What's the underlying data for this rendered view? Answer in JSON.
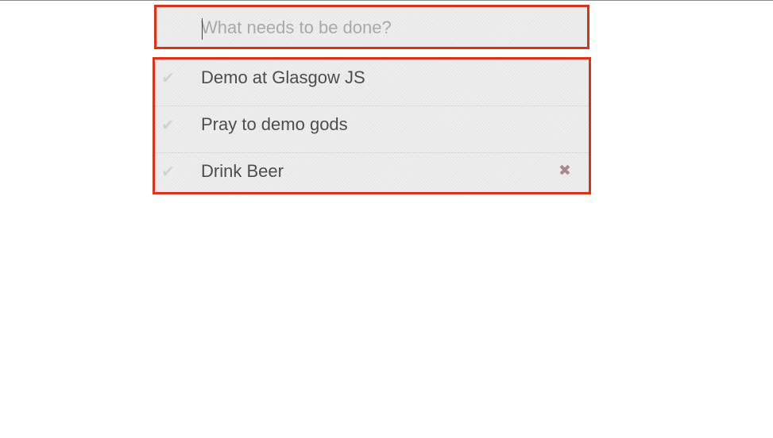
{
  "new_todo": {
    "placeholder": "What needs to be done?",
    "value": ""
  },
  "todos": [
    {
      "label": "Demo at Glasgow JS",
      "completed": false,
      "check_icon": "checkmark-icon"
    },
    {
      "label": "Pray to demo gods",
      "completed": false,
      "check_icon": "checkmark-icon"
    },
    {
      "label": "Drink Beer",
      "completed": false,
      "check_icon": "checkmark-icon",
      "destroy_icon": "close-x-icon"
    }
  ],
  "colors": {
    "highlight_border": "#dc3218",
    "panel_bg": "#ebebeb",
    "text": "#4d4d4d",
    "placeholder": "#a9a9a9",
    "check": "#d2d2d2",
    "destroy": "#a88a8a"
  }
}
